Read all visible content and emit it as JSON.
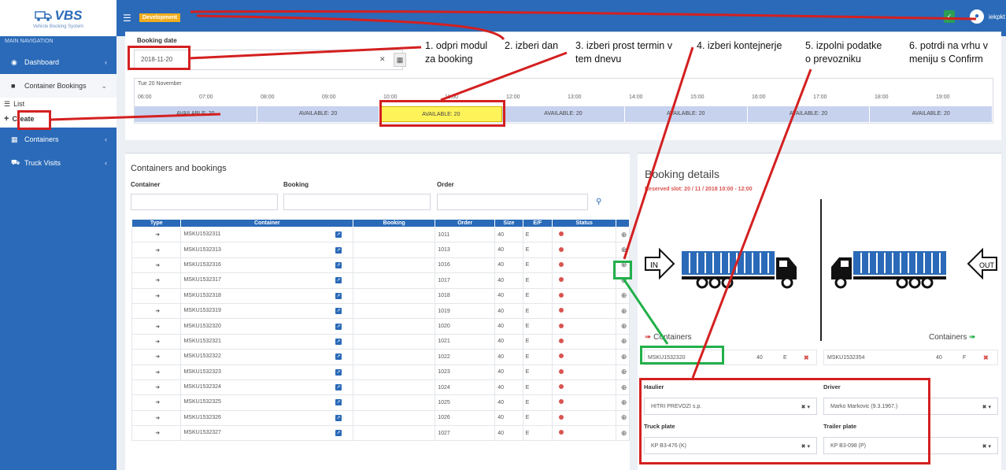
{
  "app": {
    "logo_text": "VBS",
    "logo_subtitle": "Vehicle Booking System",
    "env_badge": "Development",
    "user_name": "iekpkt"
  },
  "sidebar": {
    "header": "MAIN NAVIGATION",
    "items": [
      {
        "label": "Dashboard",
        "icon": "dashboard-icon"
      },
      {
        "label": "Container Bookings",
        "icon": "folder-icon"
      },
      {
        "label": "Containers",
        "icon": "grid-icon"
      },
      {
        "label": "Truck Visits",
        "icon": "truck-icon"
      }
    ],
    "sub_items": [
      {
        "label": "List",
        "icon": "list-icon"
      },
      {
        "label": "Create",
        "icon": "plus-icon"
      }
    ]
  },
  "booking_date": {
    "label": "Booking date",
    "value": "2018-11-20",
    "day_title": "Tue 20 November",
    "hours": [
      "06:00",
      "07:00",
      "08:00",
      "09:00",
      "10:00",
      "11:00",
      "12:00",
      "13:00",
      "14:00",
      "15:00",
      "16:00",
      "17:00",
      "18:00",
      "19:00"
    ],
    "slots": [
      "AVAILABLE: 20",
      "AVAILABLE: 20",
      "AVAILABLE: 20",
      "AVAILABLE: 20",
      "AVAILABLE: 20",
      "AVAILABLE: 20",
      "AVAILABLE: 20"
    ],
    "selected_slot_index": 2
  },
  "containers_panel": {
    "title": "Containers and bookings",
    "filters": {
      "container": "Container",
      "booking": "Booking",
      "order": "Order"
    },
    "columns": [
      "Type",
      "Container",
      "Booking",
      "Order",
      "Size",
      "E/F",
      "Status"
    ],
    "rows": [
      {
        "container": "MSKU1532311",
        "order": "1011",
        "size": "40",
        "ef": "E"
      },
      {
        "container": "MSKU1532313",
        "order": "1013",
        "size": "40",
        "ef": "E"
      },
      {
        "container": "MSKU1532316",
        "order": "1016",
        "size": "40",
        "ef": "E"
      },
      {
        "container": "MSKU1532317",
        "order": "1017",
        "size": "40",
        "ef": "E"
      },
      {
        "container": "MSKU1532318",
        "order": "1018",
        "size": "40",
        "ef": "E"
      },
      {
        "container": "MSKU1532319",
        "order": "1019",
        "size": "40",
        "ef": "E"
      },
      {
        "container": "MSKU1532320",
        "order": "1020",
        "size": "40",
        "ef": "E"
      },
      {
        "container": "MSKU1532321",
        "order": "1021",
        "size": "40",
        "ef": "E"
      },
      {
        "container": "MSKU1532322",
        "order": "1022",
        "size": "40",
        "ef": "E"
      },
      {
        "container": "MSKU1532323",
        "order": "1023",
        "size": "40",
        "ef": "E"
      },
      {
        "container": "MSKU1532324",
        "order": "1024",
        "size": "40",
        "ef": "E"
      },
      {
        "container": "MSKU1532325",
        "order": "1025",
        "size": "40",
        "ef": "E"
      },
      {
        "container": "MSKU1532326",
        "order": "1026",
        "size": "40",
        "ef": "E"
      },
      {
        "container": "MSKU1532327",
        "order": "1027",
        "size": "40",
        "ef": "E"
      }
    ]
  },
  "details": {
    "title": "Booking details",
    "reserved": "Reserved slot: 20 / 11 / 2018 10:00 - 12:00",
    "in_label": "IN",
    "out_label": "OUT",
    "containers_in_label": "Containers",
    "containers_out_label": "Containers",
    "in_container": {
      "id": "MSKU1532320",
      "size": "40",
      "ef": "E"
    },
    "out_container": {
      "id": "MSKU1532354",
      "size": "40",
      "ef": "F"
    },
    "haulier_label": "Haulier",
    "haulier_value": "HITRI PREVOZI s.p.",
    "driver_label": "Driver",
    "driver_value": "Marko Markovic (9.3.1967.)",
    "truck_plate_label": "Truck plate",
    "truck_plate_value": "KP B3-476 (K)",
    "trailer_plate_label": "Trailer plate",
    "trailer_plate_value": "KP B3-098 (P)"
  },
  "annotations": {
    "step1": "1. odpri modul\nza booking",
    "step2": "2. izberi dan",
    "step3": "3. izberi prost termin v\ntem dnevu",
    "step4": "4. izberi kontejnerje",
    "step5": "5. izpolni podatke\no prevozniku",
    "step6": "6. potrdi na vrhu v\nmeniju s Confirm"
  },
  "colors": {
    "primary": "#2a6ab8",
    "annotation_red": "#d42020",
    "annotation_green": "#22b04a",
    "selected_slot": "#fff35a",
    "badge": "#f0ad1e"
  }
}
